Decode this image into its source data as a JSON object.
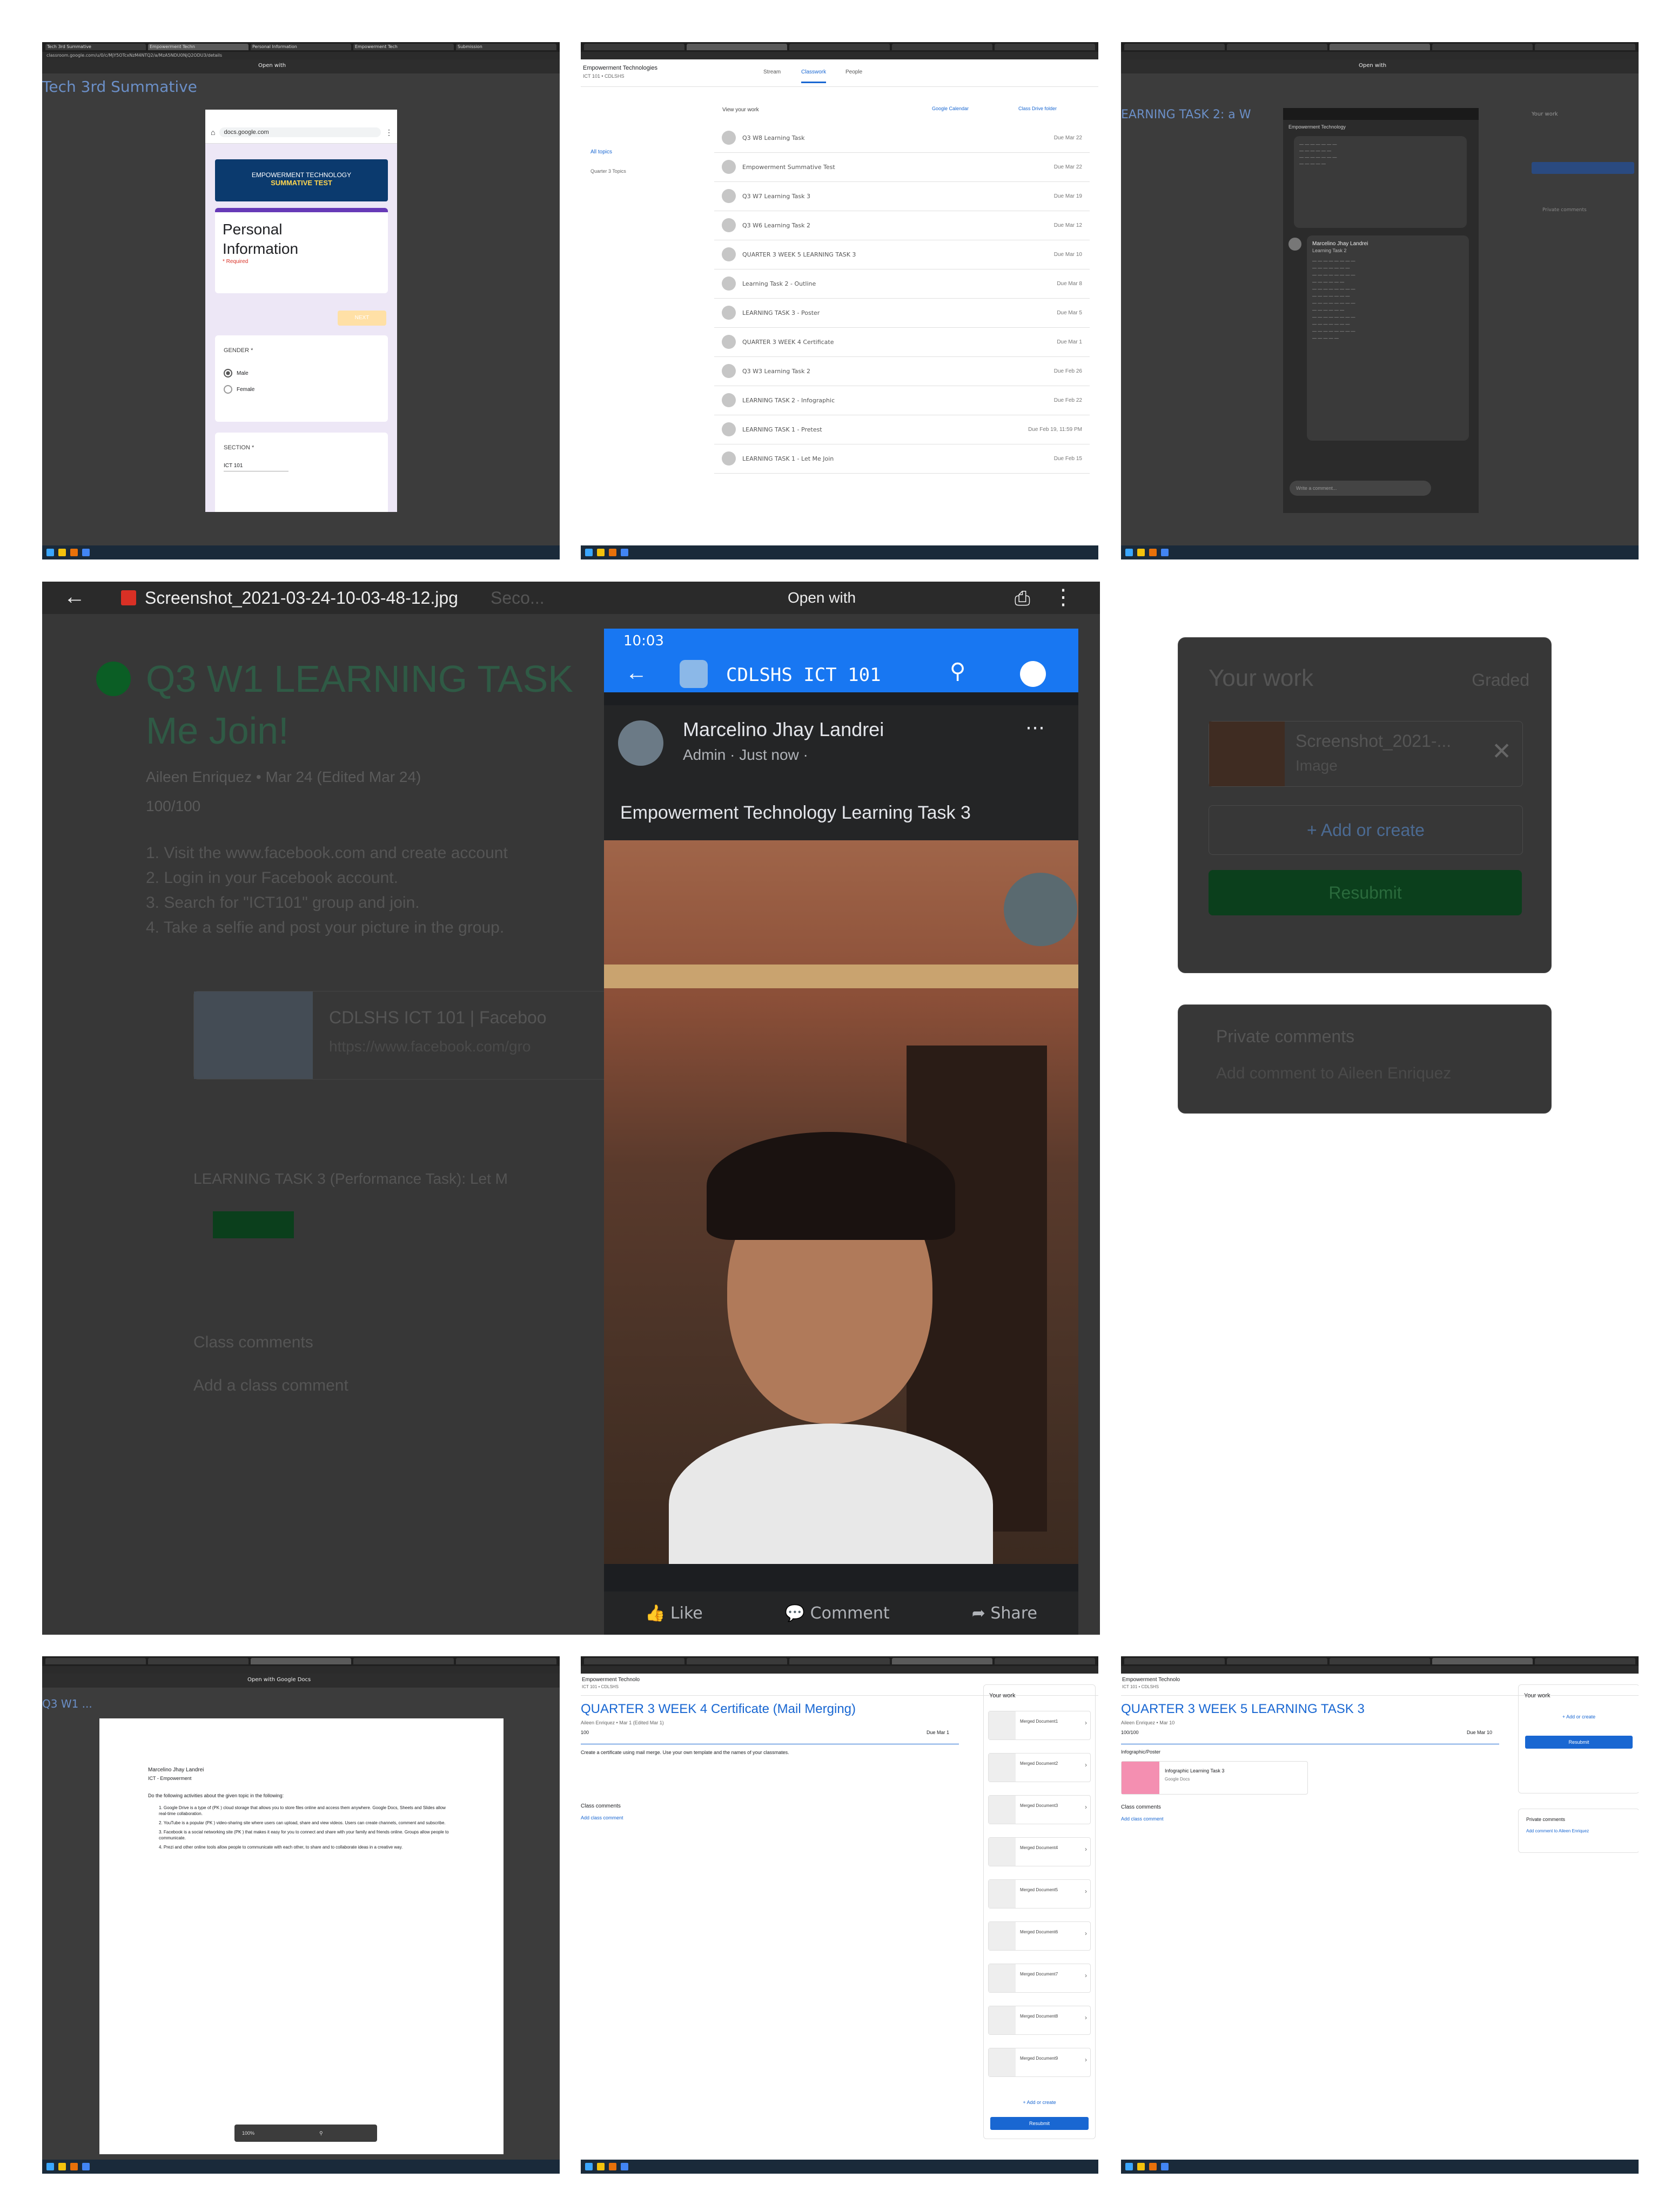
{
  "top_left": {
    "tabs": [
      "Tech 3rd Summative",
      "Empowerment Techn",
      "Personal Information",
      "Empowerment Tech",
      "Submission"
    ],
    "address": "classroom.google.com/u/0/c/MjY5OTcxNzM4NTQ2/a/MzA5NDU0NjQ2ODU3/details",
    "bg_title": "Tech 3rd Summative",
    "open_with": "Open with",
    "phone_url": "docs.google.com",
    "banner_line1": "EMPOWERMENT TECHNOLOGY",
    "banner_line2": "SUMMATIVE TEST",
    "card_title": "Personal Information",
    "required": "* Required",
    "next_button": "NEXT",
    "gender_label": "GENDER *",
    "options": [
      "Male",
      "Female"
    ],
    "section_label": "SECTION *",
    "section_value": "ICT 101"
  },
  "top_middle": {
    "class_title": "Empowerment Technologies",
    "class_sub": "ICT 101 • CDLSHS",
    "tabs": [
      "Stream",
      "Classwork",
      "People"
    ],
    "view_your_work": "View your work",
    "google_calendar": "Google Calendar",
    "class_drive": "Class Drive folder",
    "side_all": "All topics",
    "side_topic": "Quarter 3 Topics",
    "rows": [
      {
        "name": "Q3 W8 Learning Task",
        "date": "Due Mar 22"
      },
      {
        "name": "Empowerment Summative Test",
        "date": "Due Mar 22"
      },
      {
        "name": "Q3 W7 Learning Task 3",
        "date": "Due Mar 19"
      },
      {
        "name": "Q3 W6 Learning Task 2",
        "date": "Due Mar 12"
      },
      {
        "name": "QUARTER 3 WEEK 5 LEARNING TASK 3",
        "date": "Due Mar 10"
      },
      {
        "name": "Learning Task 2 - Outline",
        "date": "Due Mar 8"
      },
      {
        "name": "LEARNING TASK 3 - Poster",
        "date": "Due Mar 5"
      },
      {
        "name": "QUARTER 3 WEEK 4 Certificate",
        "date": "Due Mar 1"
      },
      {
        "name": "Q3 W3 Learning Task 2",
        "date": "Due Feb 26"
      },
      {
        "name": "LEARNING TASK 2 - Infographic",
        "date": "Due Feb 22"
      },
      {
        "name": "LEARNING TASK 1 - Pretest",
        "date": "Due Feb 19, 11:59 PM"
      },
      {
        "name": "LEARNING TASK 1 - Let Me Join",
        "date": "Due Feb 15"
      }
    ]
  },
  "top_right": {
    "bg_title": "EARNING TASK 2: a W",
    "open_with": "Open with",
    "header": "Empowerment Technology",
    "chat_name": "Marcelino Jhay Landrei",
    "chat_sub": "Learning Task 2",
    "reply": "Write a comment...",
    "your_work": "Your work",
    "resubmit": "Resubmit",
    "private_comments": "Private comments"
  },
  "middle": {
    "file_name": "Screenshot_2021-03-24-10-03-48-12.jpg",
    "open_with": "Open with",
    "bg_partial_title": "Seco...",
    "assignment_title_1": "Q3 W1 LEARNING TASK",
    "assignment_title_2": "Me Join!",
    "author_line": "Aileen Enriquez • Mar 24 (Edited Mar 24)",
    "points": "100/100",
    "instructions": [
      "1. Visit the www.facebook.com and create account",
      "2. Login in your Facebook account.",
      "3. Search for \"ICT101\" group and join.",
      "4. Take a selfie and post your picture in the group."
    ],
    "link_title": "CDLSHS ICT 101 | Faceboo",
    "link_url": "https://www.facebook.com/gro",
    "task3_label": "LEARNING TASK 3 (Performance Task): Let M",
    "class_comments": "Class comments",
    "add_class_comment": "Add a class comment",
    "your_work": "Your work",
    "graded": "Graded",
    "file_card": "Screenshot_2021-...",
    "file_type": "Image",
    "add_or_create": "+ Add or create",
    "resubmit": "Resubmit",
    "private_comments": "Private comments",
    "add_private": "Add comment to Aileen Enriquez",
    "fb": {
      "time": "10:03",
      "group_name": "CDLSHS ICT 101",
      "poster": "Marcelino Jhay Landrei",
      "meta": "Admin · Just now ·",
      "post_text": "Empowerment Technology Learning Task 3",
      "like": "Like",
      "comment": "Comment",
      "share": "Share"
    }
  },
  "bottom_left": {
    "bg_title": "Q3 W1 ...",
    "open_with": "Open with Google Docs",
    "doc_name": "Marcelino Jhay Landrei",
    "doc_sub": "ICT - Empowerment",
    "doc_intro": "Do the following activities about the given topic in the following:",
    "doc_items": [
      "1. Google Drive is a type of (PK ) cloud storage that allows you to store files online and access them anywhere. Google Docs, Sheets and Slides allow real-time collaboration.",
      "2. YouTube is a popular (PK ) video-sharing site where users can upload, share and view videos. Users can create channels, comment and subscribe.",
      "3. Facebook is a social networking site (PK ) that makes it easy for you to connect and share with your family and friends online. Groups allow people to communicate.",
      "4. Prezi and other online tools allow people to communicate with each other, to share and to collaborate ideas in a creative way."
    ],
    "zoom": "100%"
  },
  "bottom_middle": {
    "class_title": "Empowerment Technolo",
    "class_sub": "ICT 101 • CDLSHS",
    "title": "QUARTER 3 WEEK 4 Certificate (Mail Merging)",
    "author": "Aileen Enriquez • Mar 1 (Edited Mar 1)",
    "points": "100",
    "due": "Due Mar 1",
    "body": "Create a certificate using mail merge. Use your own template and the names of your classmates.",
    "your_work": "Your work",
    "files": [
      "Merged Document1",
      "Merged Document2",
      "Merged Document3",
      "Merged Document4",
      "Merged Document5",
      "Merged Document6",
      "Merged Document7",
      "Merged Document8",
      "Merged Document9"
    ],
    "more": "+ Add or create",
    "turn_in": "Resubmit",
    "class_comments": "Class comments",
    "add_comment": "Add class comment"
  },
  "bottom_right": {
    "class_title": "Empowerment Technolo",
    "class_sub": "ICT 101 • CDLSHS",
    "title": "QUARTER 3 WEEK 5 LEARNING TASK 3",
    "author": "Aileen Enriquez • Mar 10",
    "points": "100/100",
    "due": "Due Mar 10",
    "attach_label": "Infographic/Poster",
    "attach_title": "Infographic Learning Task 3",
    "attach_sub": "Google Docs",
    "class_comments": "Class comments",
    "add_comment": "Add class comment",
    "your_work": "Your work",
    "add_or_create": "+ Add or create",
    "resubmit": "Resubmit",
    "private_comments": "Private comments",
    "add_private": "Add comment to Aileen Enriquez"
  },
  "colors": {
    "classroom_blue": "#1967d2",
    "classroom_green": "#137333",
    "facebook_blue": "#1877f2",
    "forms_purple": "#673ab7"
  }
}
